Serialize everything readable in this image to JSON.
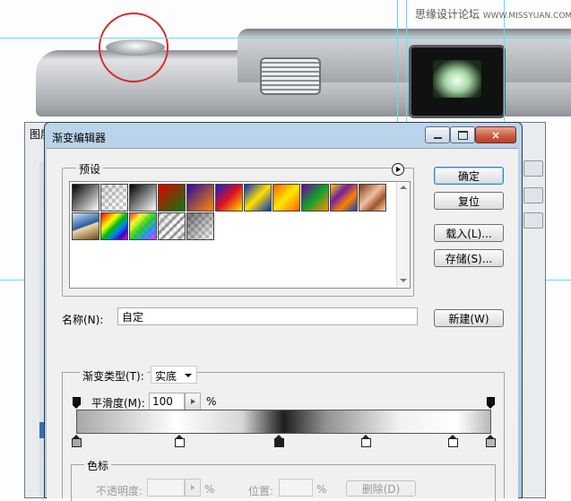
{
  "watermark": {
    "text": "思缘设计论坛",
    "site": "WWW.MISSYUAN.COM"
  },
  "background_panel": {
    "title": "图层"
  },
  "dialog": {
    "title": "渐变编辑器",
    "window_buttons": {
      "minimize": "minimize-icon",
      "maximize": "maximize-icon",
      "close": "×"
    },
    "presets": {
      "label": "预设",
      "swatches": [
        {
          "name": "foreground-to-background",
          "css": "linear-gradient(135deg, #000 0%, #fff 100%)"
        },
        {
          "name": "foreground-to-transparent",
          "css": "linear-gradient(135deg, rgba(0,0,0,.15) 0%, rgba(0,0,0,0) 100%), repeating-conic-gradient(#ccc 0% 25%, #fff 0% 50%) 0 0/8px 8px"
        },
        {
          "name": "black-white",
          "css": "linear-gradient(135deg, #000 0%, #fff 100%)"
        },
        {
          "name": "red-green",
          "css": "linear-gradient(135deg, #e00000 0%, #0a7a12 100%)"
        },
        {
          "name": "violet-orange",
          "css": "linear-gradient(135deg, #2a0aa0 0%, #ff8a00 100%)"
        },
        {
          "name": "blue-red-yellow",
          "css": "linear-gradient(135deg, #1020d0 0%, #e01020 50%, #ffe000 100%)"
        },
        {
          "name": "blue-yellow-blue",
          "css": "linear-gradient(135deg, #0030c0 0%, #ffe000 50%, #0030c0 100%)"
        },
        {
          "name": "orange-yellow-orange",
          "css": "linear-gradient(135deg, #ff6000 0%, #ffe800 50%, #ff6000 100%)"
        },
        {
          "name": "violet-green-orange",
          "css": "linear-gradient(135deg, #7000a0 0%, #10a030 50%, #ff9000 100%)"
        },
        {
          "name": "yellow-violet-orange-blue",
          "css": "linear-gradient(135deg, #ffd000 0%, #7020a0 35%, #ff8000 65%, #1040c0 100%)"
        },
        {
          "name": "copper",
          "css": "linear-gradient(135deg, #7a3a1a 0%, #f0c0a0 45%, #a0522d 70%, #f5d6c0 100%)"
        },
        {
          "name": "chrome",
          "css": "linear-gradient(160deg, #cfe4ff 0%, #2a5c9a 48%, #f0d9a8 52%, #6b4a1a 100%)"
        },
        {
          "name": "spectrum",
          "css": "linear-gradient(135deg, #ff0000, #ff8000, #ffff00, #00c000, #0080ff, #4000c0, #ff00ff)"
        },
        {
          "name": "transparent-rainbow",
          "css": "linear-gradient(135deg, rgba(255,0,0,.8), rgba(255,255,0,.8), rgba(0,200,0,.8), rgba(0,120,255,.8), rgba(255,0,255,.8)), repeating-conic-gradient(#ccc 0% 25%, #fff 0% 50%) 0 0/8px 8px"
        },
        {
          "name": "transparent-stripes",
          "css": "repeating-linear-gradient(135deg, rgba(0,0,0,.35) 0 3px, rgba(0,0,0,0) 3px 7px), repeating-conic-gradient(#ddd 0% 25%, #fff 0% 50%) 0 0/8px 8px"
        },
        {
          "name": "neutral-density",
          "css": "linear-gradient(135deg, rgba(0,0,0,.55) 0%, rgba(0,0,0,0) 100%), repeating-conic-gradient(#ccc 0% 25%, #fff 0% 50%) 0 0/8px 8px"
        }
      ]
    },
    "buttons": {
      "ok": "确定",
      "reset": "复位",
      "load": "载入(L)...",
      "save": "存储(S)...",
      "new": "新建(W)"
    },
    "name": {
      "label": "名称(N):",
      "value": "自定"
    },
    "gradient_type": {
      "label": "渐变类型(T):",
      "value": "实底"
    },
    "smoothness": {
      "label": "平滑度(M):",
      "value": "100",
      "unit": "%"
    },
    "gradient_css": "linear-gradient(90deg, #a8a8a8 0%, #ffffff 24%, #d6d6d6 40%, #1e1e1e 50%, #909090 60%, #f2f2f2 78%, #ffffff 92%, #b8b8b8 100%)",
    "opacity_stops": [
      0,
      100
    ],
    "color_stops": [
      {
        "location": 0,
        "color": "#a8a8a8"
      },
      {
        "location": 25,
        "color": "#ffffff"
      },
      {
        "location": 49,
        "color": "#1e1e1e"
      },
      {
        "location": 70,
        "color": "#ffffff"
      },
      {
        "location": 91,
        "color": "#ffffff"
      },
      {
        "location": 100,
        "color": "#b8b8b8"
      }
    ],
    "color_stops_section": {
      "label": "色标",
      "opacity_label": "不透明度:",
      "opacity_unit": "%",
      "location_label": "位置:",
      "location_unit": "%",
      "delete_label": "删除(D)"
    }
  }
}
